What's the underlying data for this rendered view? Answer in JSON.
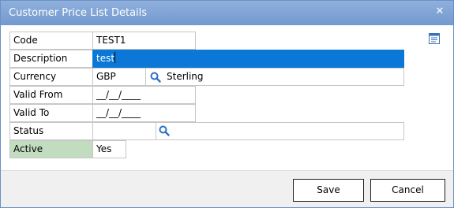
{
  "window": {
    "title": "Customer Price List Details"
  },
  "form": {
    "code": {
      "label": "Code",
      "value": "TEST1"
    },
    "description": {
      "label": "Description",
      "value": "test"
    },
    "currency": {
      "label": "Currency",
      "code": "GBP",
      "name": "Sterling"
    },
    "valid_from": {
      "label": "Valid From",
      "value": "__/__/____"
    },
    "valid_to": {
      "label": "Valid To",
      "value": "__/__/____"
    },
    "status": {
      "label": "Status",
      "code": "",
      "name": ""
    },
    "active": {
      "label": "Active",
      "value": "Yes"
    }
  },
  "buttons": {
    "save": "Save",
    "cancel": "Cancel"
  },
  "colors": {
    "titlebar": "#7fa2d6",
    "selection": "#0b78d7",
    "active_label_bg": "#c2dcbf",
    "footer_bg": "#f0f0f0"
  },
  "icons": {
    "close": "close-icon",
    "lookup": "search-icon",
    "doc": "document-icon"
  }
}
